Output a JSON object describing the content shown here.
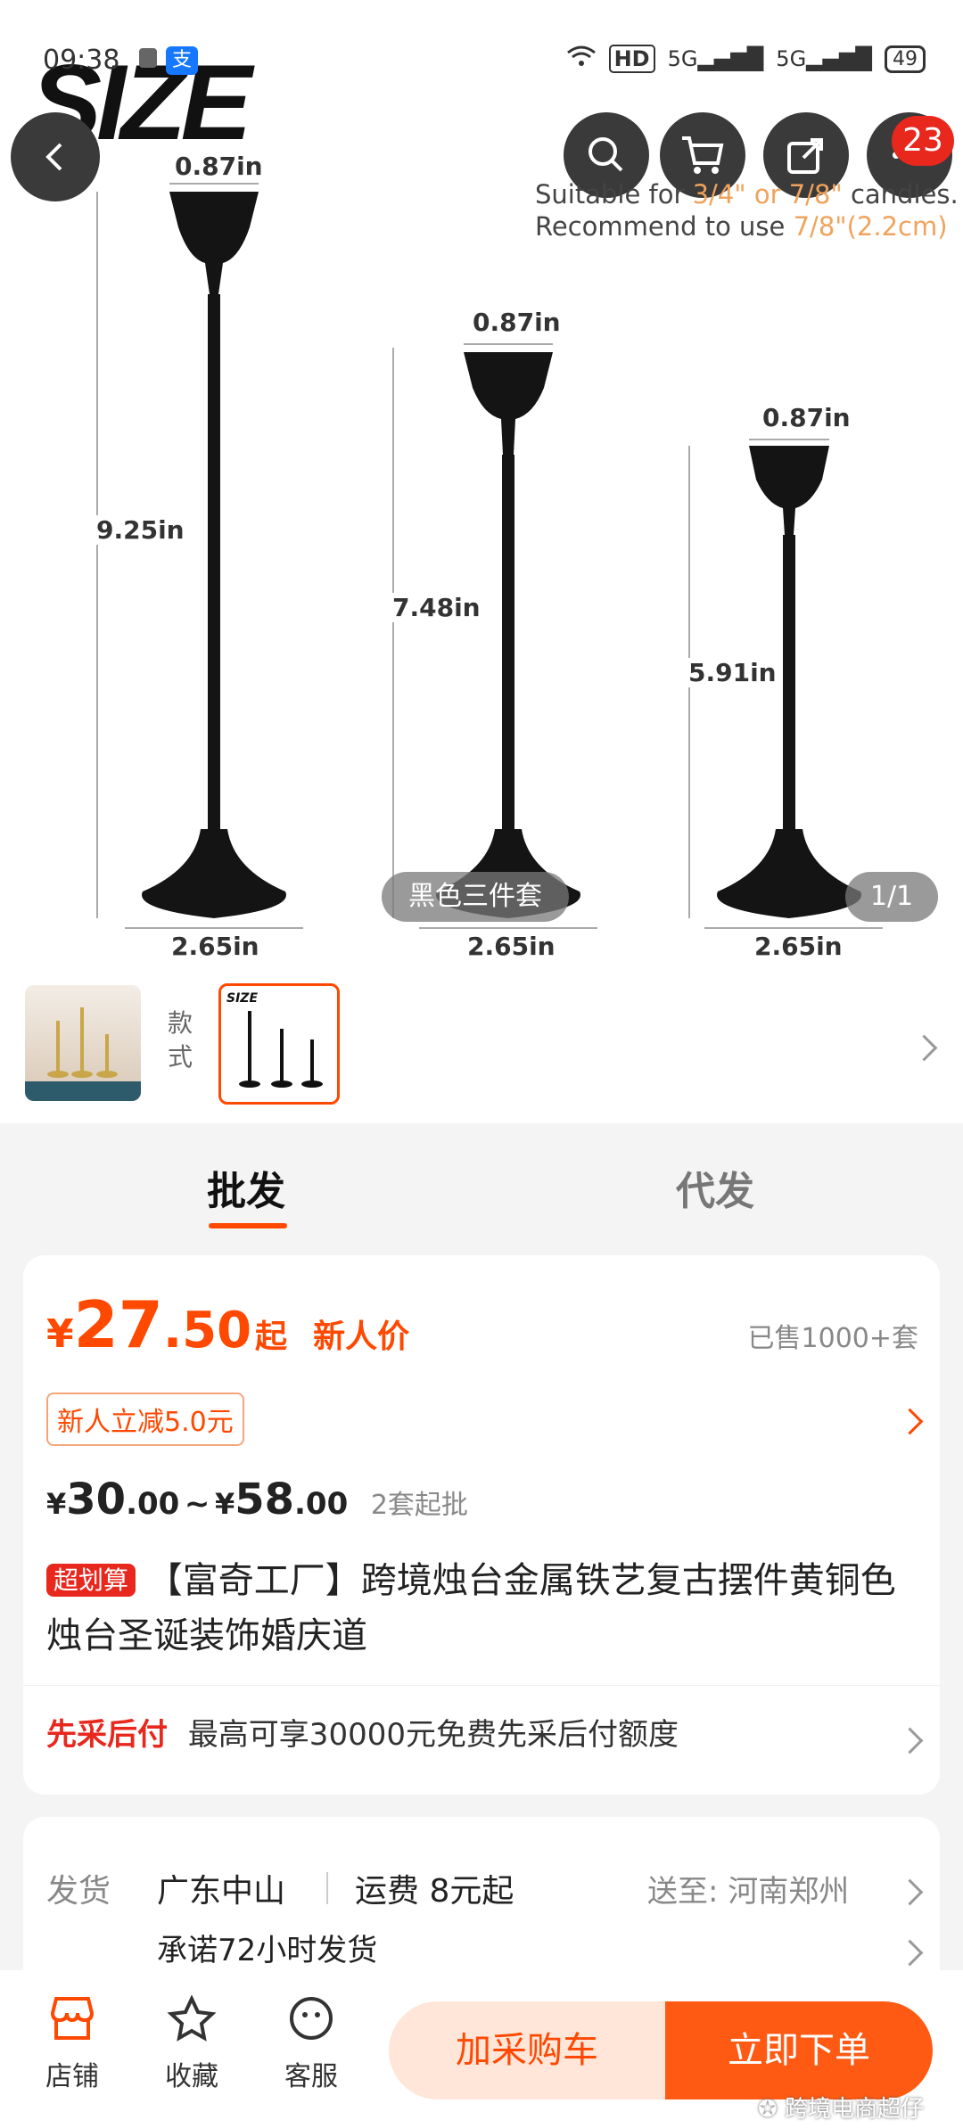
{
  "status": {
    "time": "09:38",
    "network": "HD",
    "sig1": "5G",
    "sig2": "5G",
    "battery": "49"
  },
  "hero": {
    "logo": "SIZE",
    "tip_line1_a": "Suitable for ",
    "tip_line1_b": "3/4\" or 7/8\"",
    "tip_line1_c": " candles.",
    "tip_line2_a": "Recommend to use ",
    "tip_line2_b": "7/8\"(2.2cm)",
    "cart_badge": "23",
    "dims": {
      "top1": "0.87in",
      "top2": "0.87in",
      "top3": "0.87in",
      "h1": "9.25in",
      "h2": "7.48in",
      "h3": "5.91in",
      "b1": "2.65in",
      "b2": "2.65in",
      "b3": "2.65in"
    },
    "variant_pill": "黑色三件套",
    "page_counter": "1/1"
  },
  "thumbs": {
    "style_label": "款式"
  },
  "tabs": {
    "wholesale": "批发",
    "dropship": "代发"
  },
  "price": {
    "currency": "¥",
    "int": "27",
    "dec": ".50",
    "suffix": "起",
    "new_user": "新人价",
    "sold": "已售1000+套",
    "coupon": "新人立减5.0元",
    "range_a_int": "30",
    "range_a_dec": ".00",
    "range_sep": "~",
    "range_b_int": "58",
    "range_b_dec": ".00",
    "moq": "2套起批",
    "tag": "超划算",
    "title": "【富奇工厂】跨境烛台金属铁艺复古摆件黄铜色烛台圣诞装饰婚庆道",
    "pay_later_label": "先采后付",
    "pay_later_text": "最高可享30000元免费先采后付额度"
  },
  "shipping": {
    "label": "发货",
    "origin": "广东中山",
    "fee": "运费 8元起",
    "to_label": "送至:",
    "to": "河南郑州",
    "promise": "承诺72小时发货"
  },
  "bottom": {
    "shop": "店铺",
    "fav": "收藏",
    "service": "客服",
    "add_cart": "加采购车",
    "buy_now": "立即下单",
    "watermark": "跨境电商超仔"
  },
  "colors": {
    "accent": "#ff4800",
    "pay_later": "#e8271d",
    "tag_bg": "#e8271d"
  }
}
